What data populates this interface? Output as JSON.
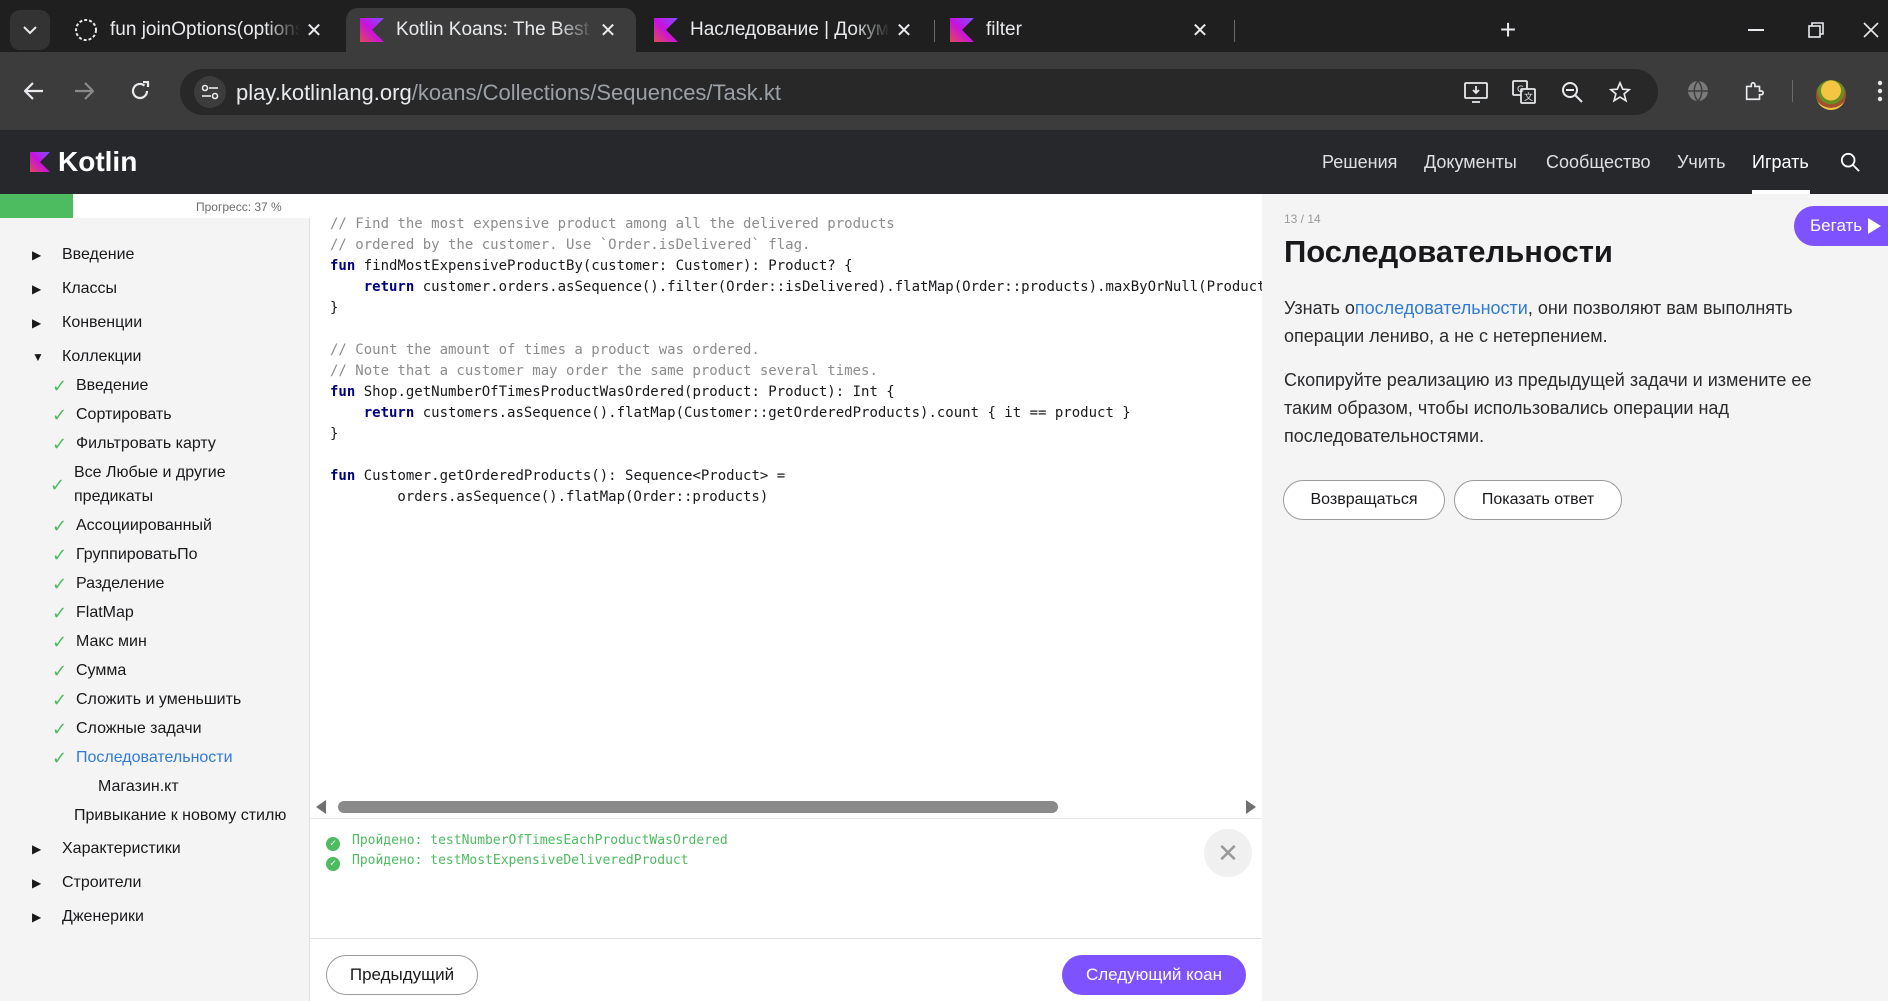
{
  "browser": {
    "tabs": [
      {
        "title": "fun joinOptions(options: Collect",
        "favicon": "chatgpt-icon",
        "active": false
      },
      {
        "title": "Kotlin Koans: The Best Way To L",
        "favicon": "kotlin-icon",
        "active": true
      },
      {
        "title": "Наследование | Документация",
        "favicon": "kotlin-icon",
        "active": false
      },
      {
        "title": "filter",
        "favicon": "kotlin-icon",
        "active": false
      }
    ],
    "url": {
      "host": "play.kotlinlang.org",
      "path": "/koans/Collections/Sequences/Task.kt"
    }
  },
  "site": {
    "logo_text": "Kotlin",
    "nav": [
      "Решения",
      "Документы",
      "Сообщество",
      "Учить",
      "Играть"
    ],
    "active_nav": "Играть",
    "accent": "#7f52ff"
  },
  "sidebar": {
    "progress_percent": 37,
    "progress_label": "Прогресс: 37 %",
    "sections": [
      {
        "label": "Введение",
        "expanded": false
      },
      {
        "label": "Классы",
        "expanded": false
      },
      {
        "label": "Конвенции",
        "expanded": false
      },
      {
        "label": "Коллекции",
        "expanded": true
      },
      {
        "label": "Характеристики",
        "expanded": false
      },
      {
        "label": "Строители",
        "expanded": false
      },
      {
        "label": "Дженерики",
        "expanded": false
      }
    ],
    "collections_items": [
      "Введение",
      "Сортировать",
      "Фильтровать карту",
      "Все Любые и другие предикаты",
      "Ассоциированный",
      "ГруппироватьПо",
      "Разделение",
      "FlatMap",
      "Макс мин",
      "Сумма",
      "Сложить и уменьшить",
      "Сложные задачи",
      "Последовательности"
    ],
    "current_item": "Последовательности",
    "current_file": "Магазин.кт",
    "next_item": "Привыкание к новому стилю"
  },
  "editor": {
    "lines": [
      {
        "type": "comment",
        "text": "// Find the most expensive product among all the delivered products"
      },
      {
        "type": "comment",
        "text": "// ordered by the customer. Use `Order.isDelivered` flag."
      },
      {
        "type": "code",
        "kw": "fun",
        "text": " findMostExpensiveProductBy(customer: Customer): Product? {"
      },
      {
        "type": "code",
        "indent": "    ",
        "kw": "return",
        "text": " customer.orders.asSequence().filter(Order::isDelivered).flatMap(Order::products).maxByOrNull(Product::"
      },
      {
        "type": "plain",
        "text": "}"
      },
      {
        "type": "plain",
        "text": ""
      },
      {
        "type": "comment",
        "text": "// Count the amount of times a product was ordered."
      },
      {
        "type": "comment",
        "text": "// Note that a customer may order the same product several times."
      },
      {
        "type": "code",
        "kw": "fun",
        "text": " Shop.getNumberOfTimesProductWasOrdered(product: Product): Int {"
      },
      {
        "type": "code",
        "indent": "    ",
        "kw": "return",
        "text": " customers.asSequence().flatMap(Customer::getOrderedProducts).count { it == product }"
      },
      {
        "type": "plain",
        "text": "}"
      },
      {
        "type": "plain",
        "text": ""
      },
      {
        "type": "code",
        "kw": "fun",
        "text": " Customer.getOrderedProducts(): Sequence<Product> ="
      },
      {
        "type": "plain",
        "text": "        orders.asSequence().flatMap(Order::products)"
      }
    ]
  },
  "console": {
    "results": [
      "Пройдено: testNumberOfTimesEachProductWasOrdered",
      "Пройдено: testMostExpensiveDeliveredProduct"
    ]
  },
  "footer": {
    "prev_label": "Предыдущий",
    "next_label": "Следующий коан"
  },
  "task": {
    "counter": "13 / 14",
    "run_label": "Бегать",
    "title": "Последовательности",
    "p1_before": "Узнать о",
    "p1_link": "последовательности",
    "p1_after": ", они позволяют вам выполнять операции лениво, а не с нетерпением.",
    "p2": "Скопируйте реализацию из предыдущей задачи и измените ее таким образом, чтобы использовались операции над последовательностями.",
    "back_label": "Возвращаться",
    "show_answer_label": "Показать ответ"
  }
}
